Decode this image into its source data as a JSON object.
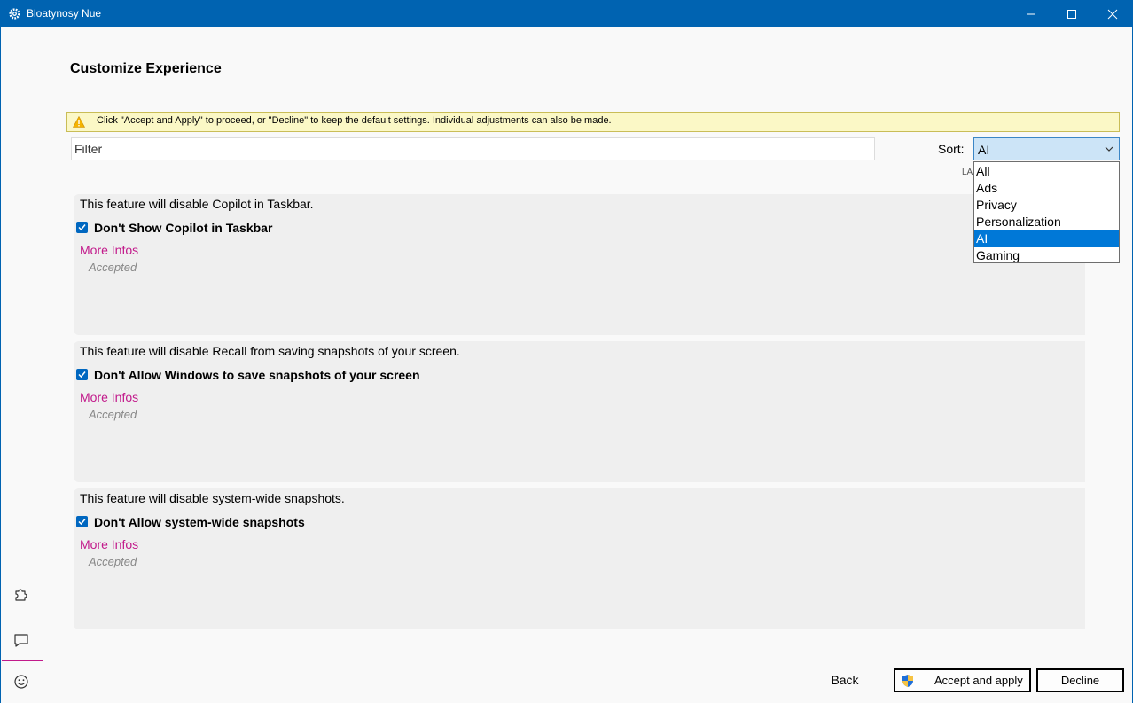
{
  "window": {
    "title": "Bloatynosy Nue"
  },
  "page": {
    "title": "Customize Experience",
    "warning": "Click \"Accept and Apply\" to proceed, or \"Decline\" to keep the default settings. Individual adjustments can also be made."
  },
  "filter": {
    "placeholder": "Filter",
    "value": ""
  },
  "sort": {
    "label": "Sort:",
    "selected": "AI",
    "hidden_label_fragment": "LA",
    "options": [
      "All",
      "Ads",
      "Privacy",
      "Personalization",
      "AI",
      "Gaming"
    ]
  },
  "features": [
    {
      "description": "This feature will disable Copilot in Taskbar.",
      "title": "Don't Show Copilot in Taskbar",
      "checked": true,
      "link": "More Infos",
      "status": "Accepted"
    },
    {
      "description": "This feature will disable Recall from saving snapshots of your screen.",
      "title": "Don't Allow Windows to save snapshots of your screen",
      "checked": true,
      "link": "More Infos",
      "status": "Accepted"
    },
    {
      "description": "This feature will disable system-wide snapshots.",
      "title": "Don't Allow system-wide snapshots",
      "checked": true,
      "link": "More Infos",
      "status": "Accepted"
    }
  ],
  "sidebar": {
    "icons": [
      "puzzle-icon",
      "chat-icon",
      "smiley-icon"
    ]
  },
  "footer": {
    "back_label": "Back",
    "accept_label": "Accept and apply",
    "decline_label": "Decline"
  },
  "colors": {
    "titlebar": "#0063b1",
    "accent": "#0078d7",
    "link": "#c21a8b",
    "warning_bg": "#fbf8c6"
  }
}
